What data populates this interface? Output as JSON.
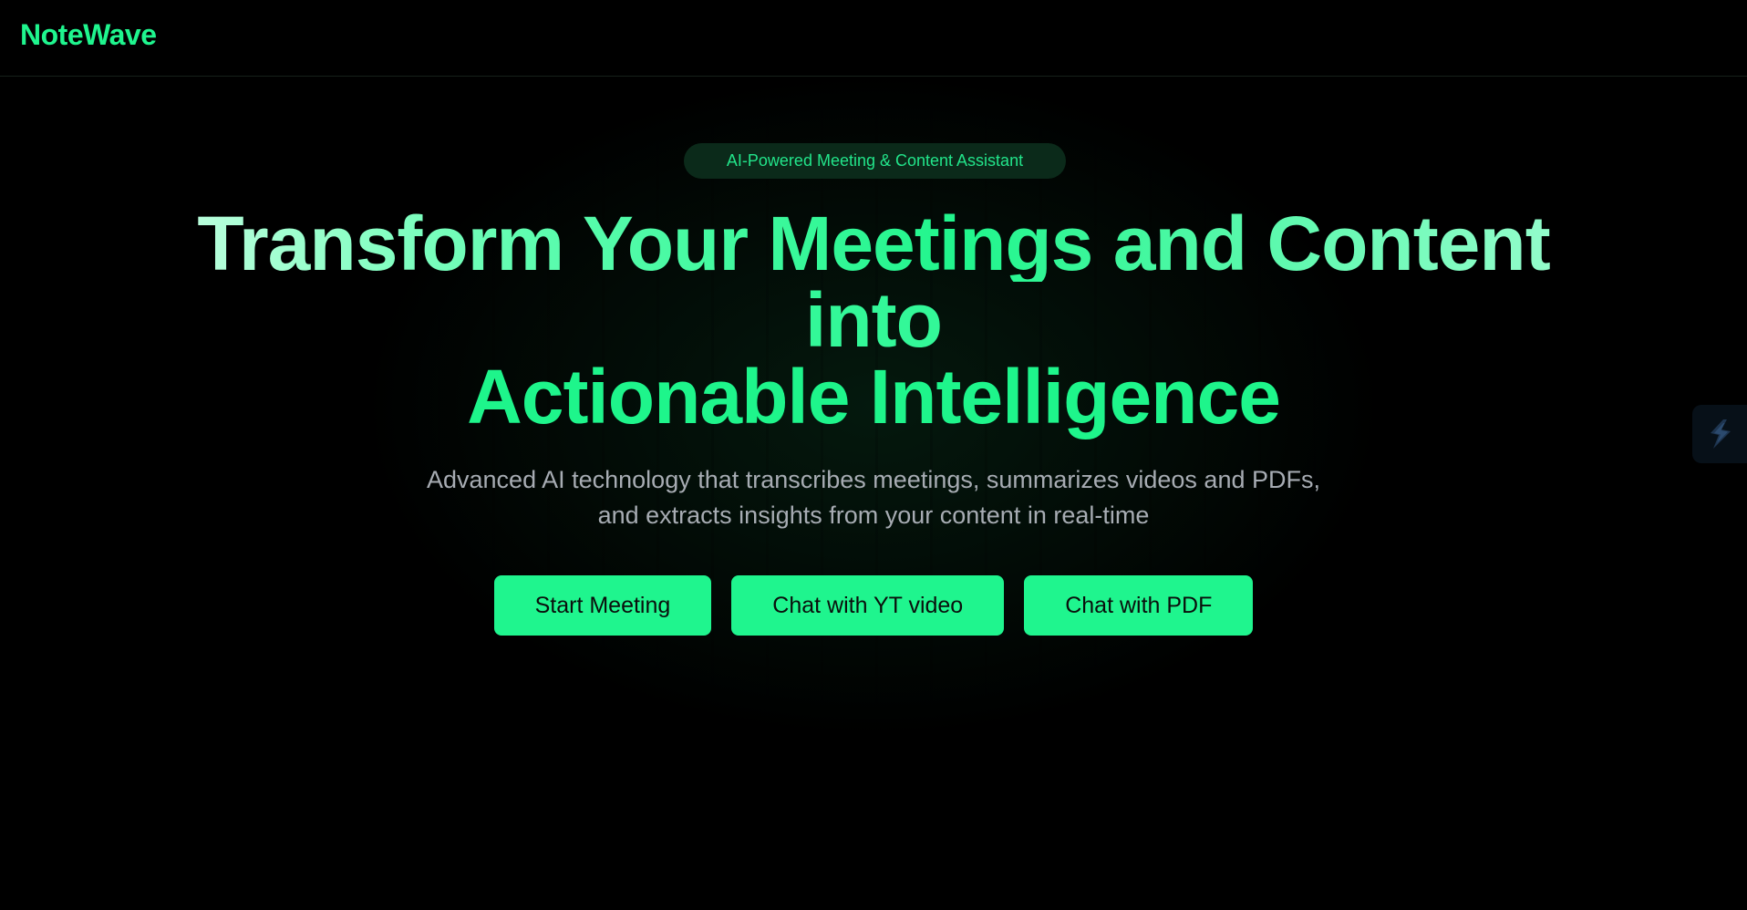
{
  "header": {
    "logo_text": "NoteWave"
  },
  "hero": {
    "badge": "AI-Powered Meeting & Content Assistant",
    "headline": {
      "line1": "Transform Your Meetings and Content",
      "line2": "into",
      "line3": "Actionable Intelligence"
    },
    "subtitle": "Advanced AI technology that transcribes meetings, summarizes videos and PDFs, and extracts insights from your content in real-time",
    "buttons": [
      {
        "label": "Start Meeting"
      },
      {
        "label": "Chat with YT video"
      },
      {
        "label": "Chat with PDF"
      }
    ]
  },
  "floating_widget": {
    "icon": "bolt-icon"
  },
  "colors": {
    "accent": "#1ff58e",
    "background": "#000000",
    "subtitle": "#a7acb3",
    "badge_bg": "#0b2a1a"
  }
}
